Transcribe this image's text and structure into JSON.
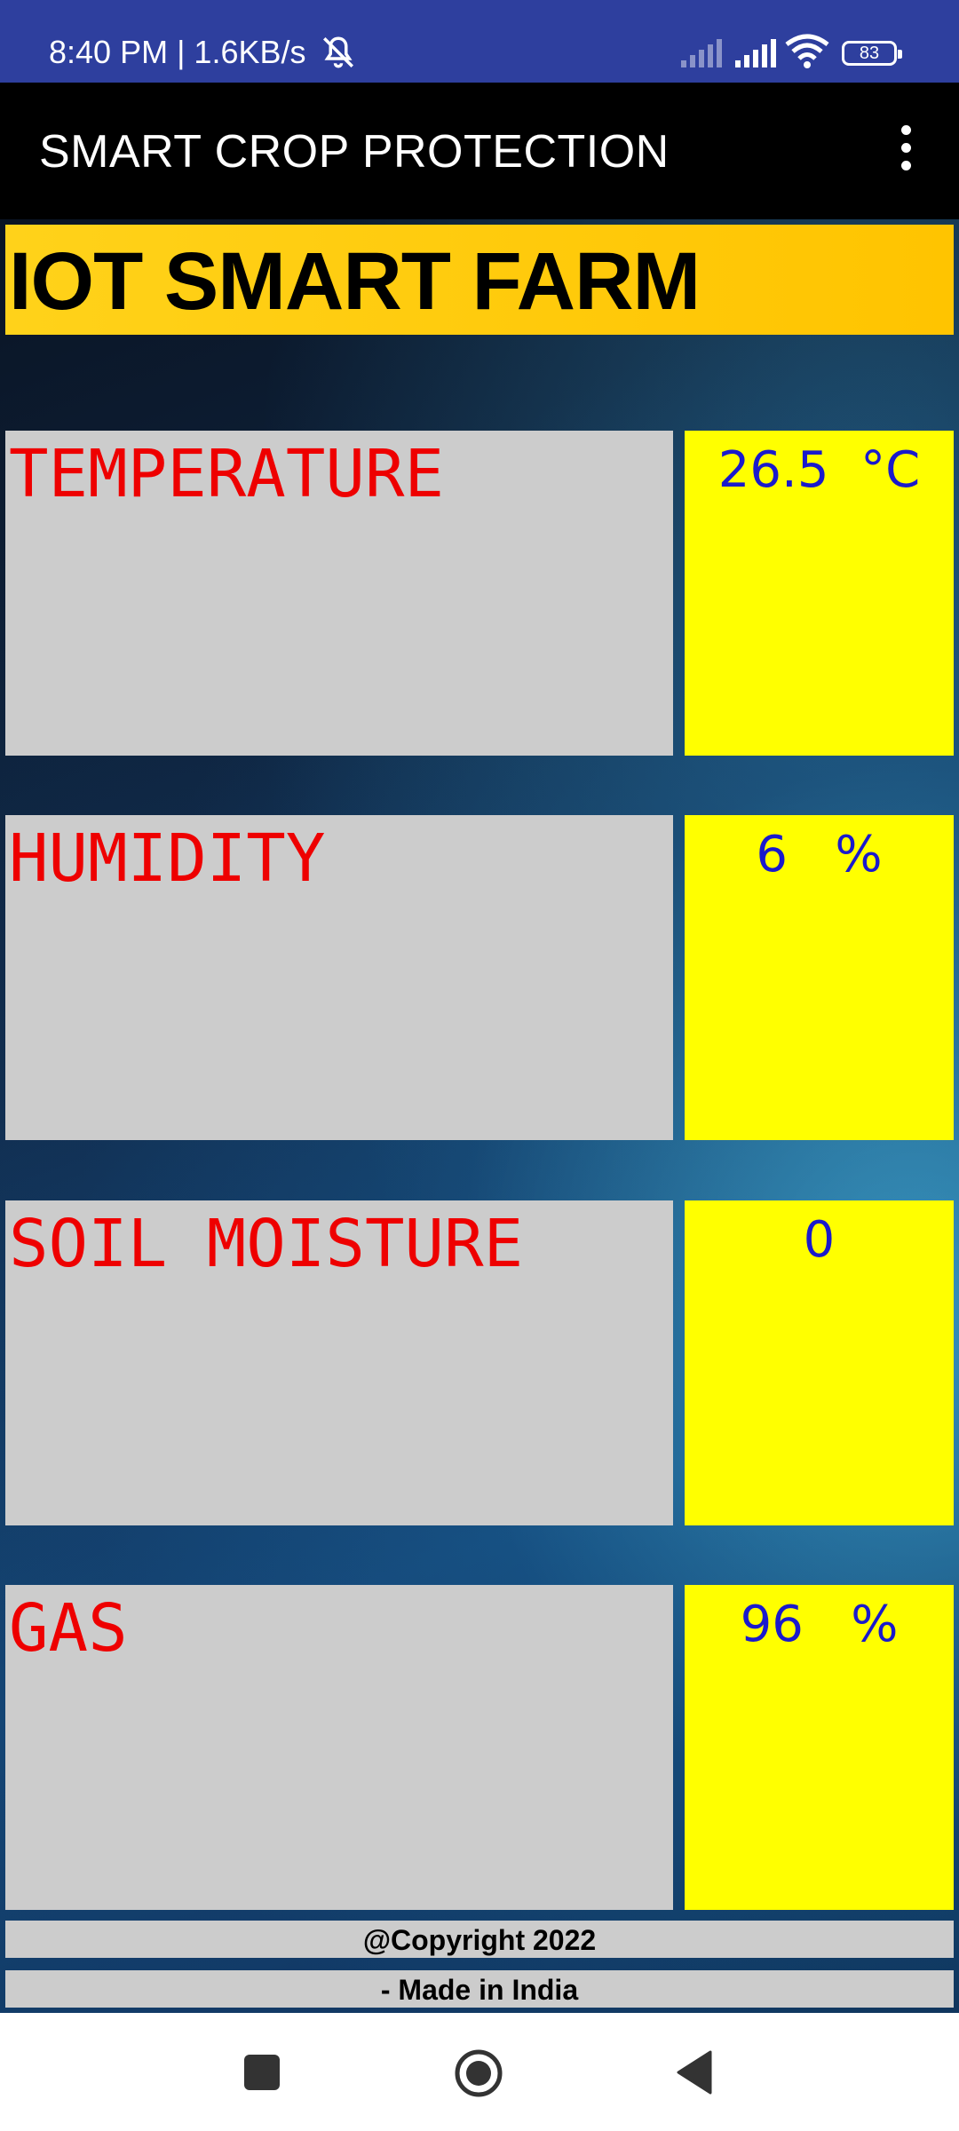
{
  "status_bar": {
    "time_speed": "8:40 PM | 1.6KB/s",
    "battery": "83"
  },
  "app_bar": {
    "title": "SMART CROP PROTECTION"
  },
  "banner": {
    "title": "IOT SMART FARM"
  },
  "readings": [
    {
      "label": "TEMPERATURE",
      "value": "26.5  °C"
    },
    {
      "label": "HUMIDITY",
      "value": "6   %"
    },
    {
      "label": "SOIL MOISTURE",
      "value": "0"
    },
    {
      "label": "GAS",
      "value": "96   %"
    }
  ],
  "footer": {
    "copyright": "@Copyright 2022",
    "made_in": "- Made in India"
  },
  "colors": {
    "status_bar": "#2e3f9e",
    "app_bar": "#000000",
    "banner": "#ffc400",
    "label_bg": "#cccccc",
    "label_text": "#ee0000",
    "value_bg": "#ffff00",
    "value_text": "#1a1acc"
  },
  "icons": [
    "mute-icon",
    "signal-icon",
    "wifi-icon",
    "battery-icon",
    "overflow-menu-icon",
    "recent-apps-icon",
    "home-icon",
    "back-icon"
  ]
}
